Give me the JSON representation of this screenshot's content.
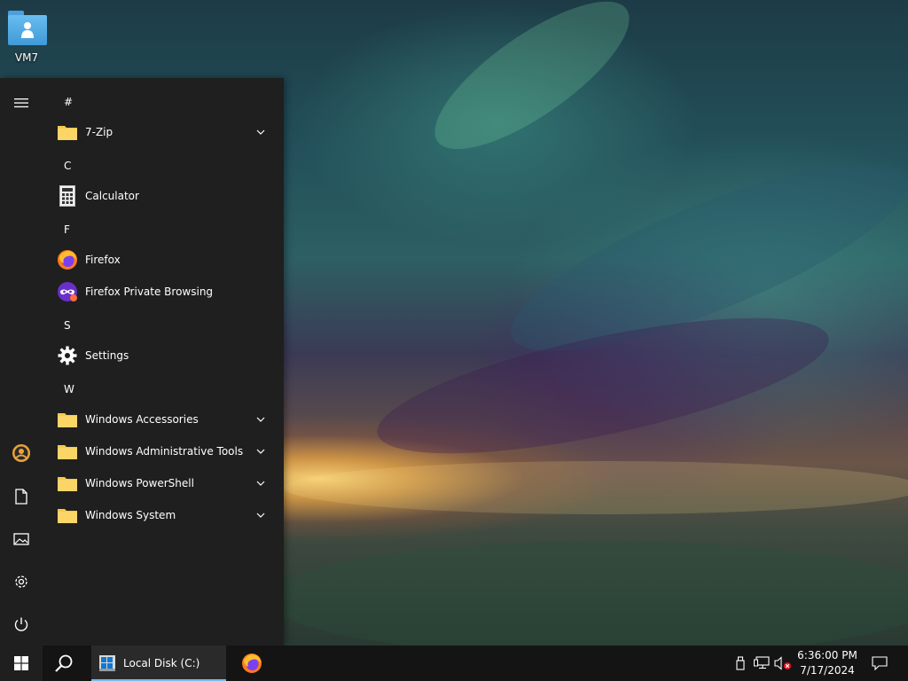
{
  "desktop": {
    "icon_label": "VM7"
  },
  "start_menu": {
    "groups": [
      {
        "letter": "#",
        "items": [
          {
            "label": "7-Zip",
            "icon": "folder-icon",
            "expandable": true
          }
        ]
      },
      {
        "letter": "C",
        "items": [
          {
            "label": "Calculator",
            "icon": "calculator-icon",
            "expandable": false
          }
        ]
      },
      {
        "letter": "F",
        "items": [
          {
            "label": "Firefox",
            "icon": "firefox-icon",
            "expandable": false
          },
          {
            "label": "Firefox Private Browsing",
            "icon": "firefox-private-icon",
            "expandable": false
          }
        ]
      },
      {
        "letter": "S",
        "items": [
          {
            "label": "Settings",
            "icon": "gear-icon",
            "expandable": false
          }
        ]
      },
      {
        "letter": "W",
        "items": [
          {
            "label": "Windows Accessories",
            "icon": "folder-icon",
            "expandable": true
          },
          {
            "label": "Windows Administrative Tools",
            "icon": "folder-icon",
            "expandable": true
          },
          {
            "label": "Windows PowerShell",
            "icon": "folder-icon",
            "expandable": true
          },
          {
            "label": "Windows System",
            "icon": "folder-icon",
            "expandable": true
          }
        ]
      }
    ],
    "rail_icons": [
      "hamburger-icon",
      "user-account-icon",
      "documents-icon",
      "pictures-icon",
      "settings-icon",
      "power-icon"
    ]
  },
  "taskbar": {
    "explorer_label": "Local Disk (C:)",
    "clock_time": "6:36:00 PM",
    "clock_date": "7/17/2024"
  },
  "colors": {
    "start_menu_bg": "#1f1f1f",
    "taskbar_bg": "#141414",
    "accent": "#76b9ed",
    "folder_yellow": "#f8c94a"
  }
}
